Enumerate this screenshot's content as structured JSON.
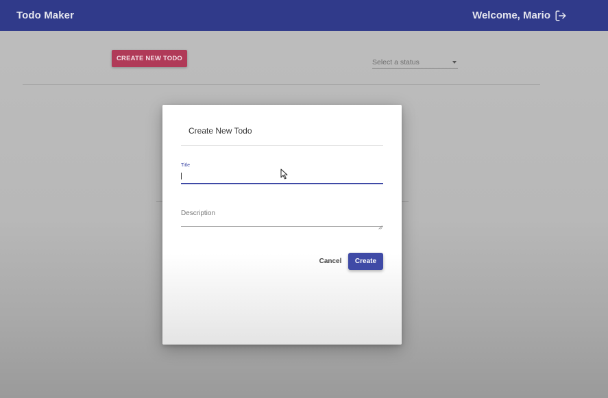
{
  "appbar": {
    "title": "Todo Maker",
    "welcome": "Welcome, Mario",
    "logout_icon": "logout-icon"
  },
  "toolbar": {
    "create_label": "CREATE NEW TODO",
    "status_placeholder": "Select a status"
  },
  "dialog": {
    "title": "Create New Todo",
    "fields": {
      "title_label": "Title",
      "title_value": "",
      "description_placeholder": "Description"
    },
    "cancel_label": "Cancel",
    "create_label": "Create"
  },
  "colors": {
    "appbar": "#303a8a",
    "primary": "#3f4aa6",
    "secondary": "#b03a58"
  }
}
